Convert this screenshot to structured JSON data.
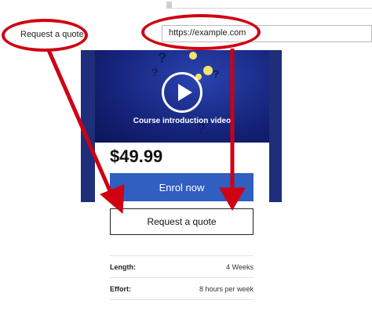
{
  "browser": {
    "url": "https://example.com"
  },
  "callouts": {
    "left_label": "Request a quote",
    "right_label": "https://example.com"
  },
  "video": {
    "caption": "Course introduction video",
    "q_mark": "?"
  },
  "product": {
    "price": "$49.99",
    "enrol_label": "Enrol now",
    "quote_label": "Request a quote",
    "details": [
      {
        "key": "Length:",
        "value": "4 Weeks"
      },
      {
        "key": "Effort:",
        "value": "8 hours per week"
      }
    ]
  },
  "colors": {
    "callout": "#d00012",
    "brand_blue": "#2f5fc0",
    "video_bg": "#15237a"
  }
}
